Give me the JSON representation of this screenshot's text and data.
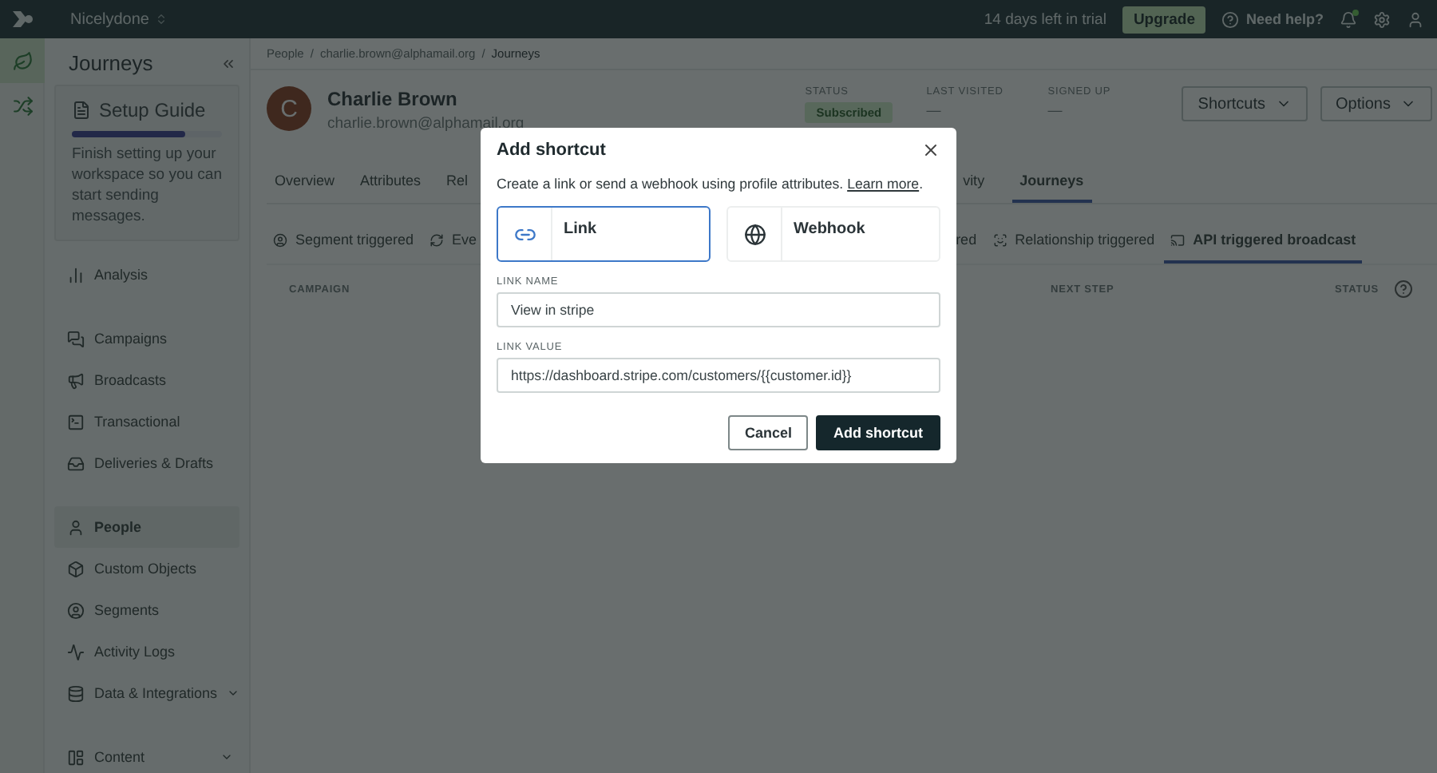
{
  "topbar": {
    "workspace": "Nicelydone",
    "trial": "14 days left in trial",
    "upgrade": "Upgrade",
    "help": "Need help?",
    "has_unread": true
  },
  "rail": [
    {
      "selected": true
    },
    {
      "selected": false
    }
  ],
  "sidebar": {
    "title": "Journeys",
    "setup_guide": {
      "title": "Setup Guide",
      "level": 0.75,
      "text": "Finish setting up your workspace so you can start sending messages."
    },
    "sections": [
      {
        "items": [
          {
            "label": "Analysis",
            "selected": false,
            "has_menu": false
          }
        ]
      },
      {
        "items": [
          {
            "label": "Campaigns",
            "selected": false,
            "has_menu": false
          },
          {
            "label": "Broadcasts",
            "selected": false,
            "has_menu": false
          },
          {
            "label": "Transactional",
            "selected": false,
            "has_menu": false
          },
          {
            "label": "Deliveries & Drafts",
            "selected": false,
            "has_menu": false
          }
        ]
      },
      {
        "items": [
          {
            "label": "People",
            "selected": true,
            "has_menu": false
          },
          {
            "label": "Custom Objects",
            "selected": false,
            "has_menu": false
          },
          {
            "label": "Segments",
            "selected": false,
            "has_menu": false
          },
          {
            "label": "Activity Logs",
            "selected": false,
            "has_menu": false
          },
          {
            "label": "Data & Integrations",
            "selected": false,
            "has_menu": true
          }
        ]
      },
      {
        "items": [
          {
            "label": "Content",
            "selected": false,
            "has_menu": true
          }
        ]
      }
    ]
  },
  "breadcrumbs": {
    "items": [
      "People",
      "charlie.brown@alphamail.org",
      "Journeys"
    ],
    "separator": "/"
  },
  "profile": {
    "initial": "C",
    "name": "Charlie Brown",
    "email": "charlie.brown@alphamail.org",
    "stats": [
      {
        "label": "STATUS",
        "value": "Subscribed",
        "kind": "badge"
      },
      {
        "label": "LAST VISITED",
        "value": "—",
        "kind": "text"
      },
      {
        "label": "SIGNED UP",
        "value": "—",
        "kind": "text"
      }
    ],
    "buttons": [
      "Shortcuts",
      "Options"
    ]
  },
  "tabs": {
    "before_dialog": [
      {
        "label": "Overview",
        "selected": false
      },
      {
        "label": "Attributes",
        "selected": false
      },
      {
        "label": "Rel",
        "selected": false
      }
    ],
    "after_dialog": [
      {
        "label": "vity",
        "selected": false
      },
      {
        "label": "Journeys",
        "selected": true
      }
    ]
  },
  "subtabs": {
    "before_dialog": [
      {
        "label": "Segment triggered",
        "selected": false
      },
      {
        "label": "Eve",
        "selected": false
      }
    ],
    "after_dialog": [
      {
        "label": "red",
        "selected": false
      },
      {
        "label": "Relationship triggered",
        "selected": false
      },
      {
        "label": "API triggered broadcast",
        "selected": true
      }
    ]
  },
  "table": {
    "columns": [
      "CAMPAIGN",
      "NEXT STEP",
      "STATUS"
    ]
  },
  "dialog": {
    "title": "Add shortcut",
    "description": "Create a link or send a webhook using profile attributes.",
    "link": "Learn more",
    "suffix": ".",
    "options": [
      {
        "label": "Link",
        "kind": "link",
        "selected": true
      },
      {
        "label": "Webhook",
        "kind": "webhook",
        "selected": false
      }
    ],
    "fields": [
      {
        "label": "LINK NAME",
        "value": "View in stripe"
      },
      {
        "label": "LINK VALUE",
        "value": "https://dashboard.stripe.com/customers/{{customer.id}}"
      }
    ],
    "buttons": [
      {
        "label": "Cancel",
        "kind": "secondary"
      },
      {
        "label": "Add shortcut",
        "kind": "primary"
      }
    ]
  }
}
